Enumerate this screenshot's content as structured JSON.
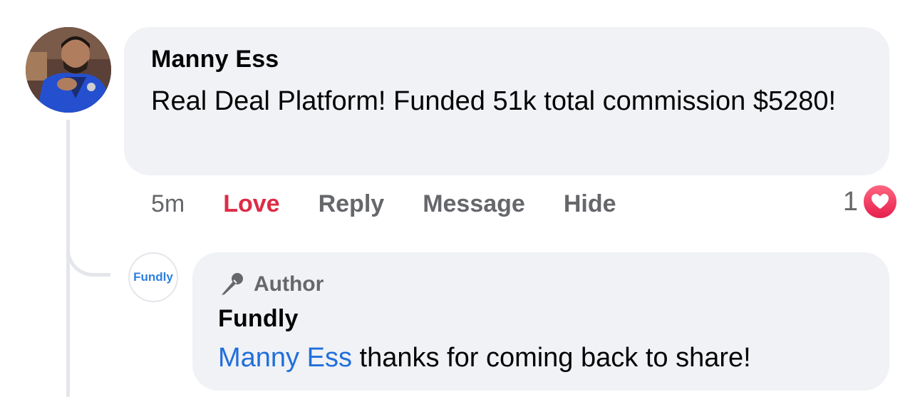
{
  "comment": {
    "avatar_icon": "user-avatar-photo",
    "author": "Manny Ess",
    "text": "Real Deal Platform! Funded 51k total commission $5280!",
    "time": "5m",
    "actions": {
      "love": "Love",
      "reply": "Reply",
      "message": "Message",
      "hide": "Hide"
    },
    "reactions": {
      "count": "1",
      "icon": "heart-icon"
    }
  },
  "reply": {
    "avatar_text": "Fundly",
    "badge_icon": "microphone-icon",
    "badge_label": "Author",
    "author": "Fundly",
    "mention": "Manny Ess",
    "text": " thanks for coming back to share!"
  },
  "colors": {
    "bubble": "#f0f2f5",
    "love": "#dd2c46",
    "mention": "#216fdb",
    "secondary_text": "#65676b",
    "thread_line": "#e4e6eb"
  }
}
